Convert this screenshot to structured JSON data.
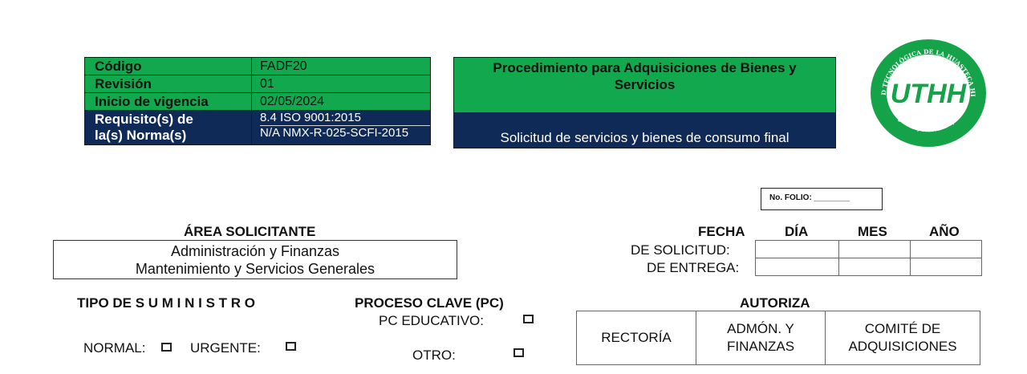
{
  "header": {
    "meta": [
      {
        "key": "Código",
        "value": "FADF20"
      },
      {
        "key": "Revisión",
        "value": "01"
      },
      {
        "key": "Inicio de vigencia",
        "value": "02/05/2024"
      }
    ],
    "requisito_key_line1": "Requisito(s) de",
    "requisito_key_line2": "la(s) Norma(s)",
    "requisito_values": [
      "8.4 ISO 9001:2015",
      "N/A NMX-R-025-SCFI-2015"
    ],
    "procedure_title_line1": "Procedimiento para Adquisiciones de Bienes y",
    "procedure_title_line2": "Servicios",
    "procedure_subtitle": "Solicitud de servicios y bienes de consumo final",
    "logo_text": "UTHH",
    "logo_ring_top": "UNIVERSIDAD TECNOLÓGICA DE LA HUASTECA HIDALGUENSE",
    "logo_ring_bottom": "HUEJUTLA, HIDALGO, MEX.",
    "colors": {
      "green": "#12a84e",
      "navy": "#102a57"
    }
  },
  "folio": "No. FOLIO: ________",
  "area": {
    "title": "ÁREA SOLICITANTE",
    "line1": "Administración y Finanzas",
    "line2": "Mantenimiento y Servicios Generales"
  },
  "fecha": {
    "title": "FECHA",
    "cols": [
      "DÍA",
      "MES",
      "AÑO"
    ],
    "rows": [
      "DE SOLICITUD:",
      "DE ENTREGA:"
    ]
  },
  "suministro": {
    "title": "TIPO DE S U M I N I S T R O",
    "normal": "NORMAL:",
    "urgente": "URGENTE:"
  },
  "proceso": {
    "title": "PROCESO CLAVE (PC)",
    "educativo": "PC EDUCATIVO:",
    "otro": "OTRO:"
  },
  "autoriza": {
    "title": "AUTORIZA",
    "c1": "RECTORÍA",
    "c2_l1": "ADMÓN. Y",
    "c2_l2": "FINANZAS",
    "c3_l1": "COMITÉ DE",
    "c3_l2": "ADQUISICIONES"
  }
}
